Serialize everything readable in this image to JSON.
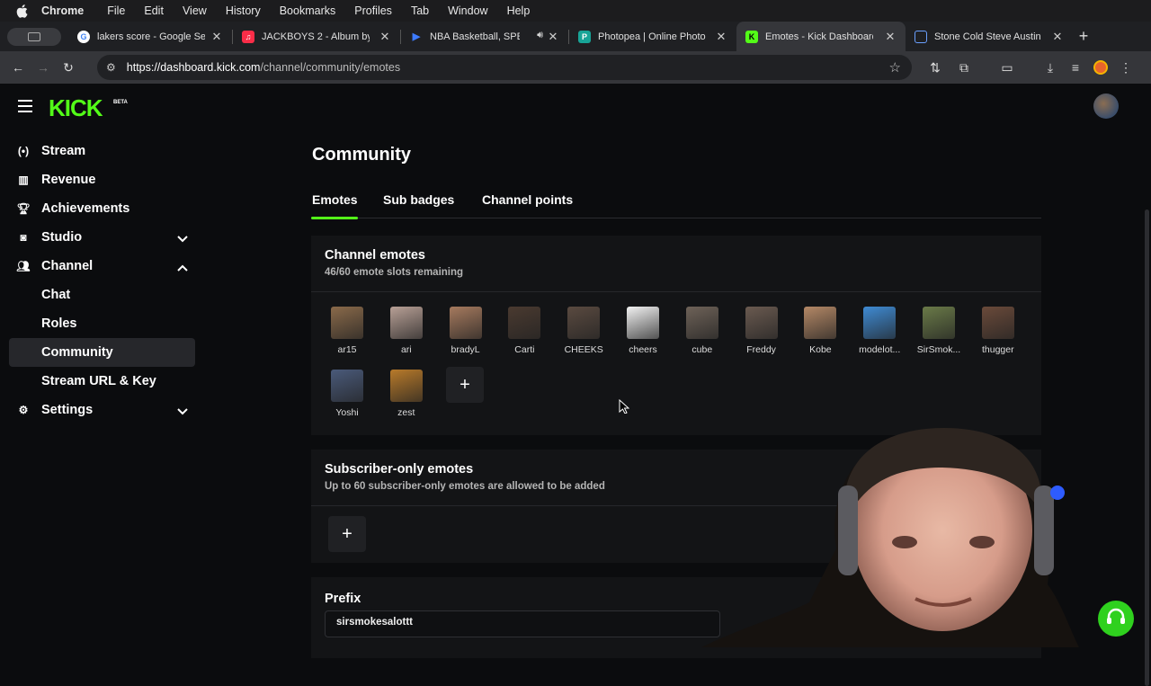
{
  "menubar": {
    "app": "Chrome",
    "items": [
      "File",
      "Edit",
      "View",
      "History",
      "Bookmarks",
      "Profiles",
      "Tab",
      "Window",
      "Help"
    ]
  },
  "tabs": [
    {
      "title": "lakers score - Google Se",
      "icon": "google-icon"
    },
    {
      "title": "JACKBOYS 2 - Album by",
      "icon": "apple-music-icon"
    },
    {
      "title": "NBA Basketball, SPE",
      "icon": "play-icon"
    },
    {
      "title": "Photopea | Online Photo",
      "icon": "photopea-icon"
    },
    {
      "title": "Emotes - Kick Dashboard",
      "icon": "kick-icon",
      "active": true
    },
    {
      "title": "Stone Cold Steve Austin",
      "icon": "doc-icon"
    }
  ],
  "url": {
    "host": "https://dashboard.kick.com",
    "path": "/channel/community/emotes"
  },
  "brand": {
    "logo": "KICK",
    "beta": "BETA",
    "accent": "#53fc18"
  },
  "sidebar": {
    "items": [
      {
        "label": "Stream",
        "icon": "stream-icon"
      },
      {
        "label": "Revenue",
        "icon": "revenue-icon"
      },
      {
        "label": "Achievements",
        "icon": "trophy-icon"
      },
      {
        "label": "Studio",
        "icon": "studio-icon"
      },
      {
        "label": "Channel",
        "icon": "channel-icon"
      },
      {
        "label": "Chat"
      },
      {
        "label": "Roles"
      },
      {
        "label": "Community"
      },
      {
        "label": "Stream URL & Key"
      },
      {
        "label": "Settings",
        "icon": "gear-icon"
      }
    ]
  },
  "page": {
    "title": "Community",
    "tabs": [
      "Emotes",
      "Sub badges",
      "Channel points"
    ]
  },
  "channel_emotes": {
    "title": "Channel emotes",
    "subtitle": "46/60 emote slots remaining",
    "emotes": [
      "ar15",
      "ari",
      "bradyL",
      "Carti",
      "CHEEKS",
      "cheers",
      "cube",
      "Freddy",
      "Kobe",
      "modelot...",
      "SirSmok...",
      "thugger",
      "Yoshi",
      "zest"
    ],
    "add": "+"
  },
  "subscriber_emotes": {
    "title": "Subscriber-only emotes",
    "subtitle": "Up to 60 subscriber-only emotes are allowed to be added",
    "add": "+"
  },
  "prefix": {
    "title": "Prefix",
    "value": "sirsmokesalottt"
  }
}
